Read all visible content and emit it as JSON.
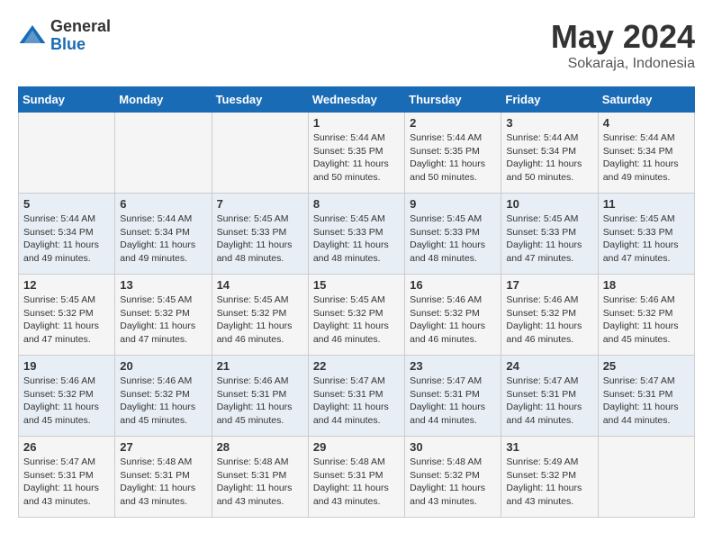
{
  "logo": {
    "general": "General",
    "blue": "Blue"
  },
  "title": {
    "month": "May 2024",
    "location": "Sokaraja, Indonesia"
  },
  "headers": [
    "Sunday",
    "Monday",
    "Tuesday",
    "Wednesday",
    "Thursday",
    "Friday",
    "Saturday"
  ],
  "weeks": [
    [
      {
        "day": "",
        "info": ""
      },
      {
        "day": "",
        "info": ""
      },
      {
        "day": "",
        "info": ""
      },
      {
        "day": "1",
        "info": "Sunrise: 5:44 AM\nSunset: 5:35 PM\nDaylight: 11 hours\nand 50 minutes."
      },
      {
        "day": "2",
        "info": "Sunrise: 5:44 AM\nSunset: 5:35 PM\nDaylight: 11 hours\nand 50 minutes."
      },
      {
        "day": "3",
        "info": "Sunrise: 5:44 AM\nSunset: 5:34 PM\nDaylight: 11 hours\nand 50 minutes."
      },
      {
        "day": "4",
        "info": "Sunrise: 5:44 AM\nSunset: 5:34 PM\nDaylight: 11 hours\nand 49 minutes."
      }
    ],
    [
      {
        "day": "5",
        "info": "Sunrise: 5:44 AM\nSunset: 5:34 PM\nDaylight: 11 hours\nand 49 minutes."
      },
      {
        "day": "6",
        "info": "Sunrise: 5:44 AM\nSunset: 5:34 PM\nDaylight: 11 hours\nand 49 minutes."
      },
      {
        "day": "7",
        "info": "Sunrise: 5:45 AM\nSunset: 5:33 PM\nDaylight: 11 hours\nand 48 minutes."
      },
      {
        "day": "8",
        "info": "Sunrise: 5:45 AM\nSunset: 5:33 PM\nDaylight: 11 hours\nand 48 minutes."
      },
      {
        "day": "9",
        "info": "Sunrise: 5:45 AM\nSunset: 5:33 PM\nDaylight: 11 hours\nand 48 minutes."
      },
      {
        "day": "10",
        "info": "Sunrise: 5:45 AM\nSunset: 5:33 PM\nDaylight: 11 hours\nand 47 minutes."
      },
      {
        "day": "11",
        "info": "Sunrise: 5:45 AM\nSunset: 5:33 PM\nDaylight: 11 hours\nand 47 minutes."
      }
    ],
    [
      {
        "day": "12",
        "info": "Sunrise: 5:45 AM\nSunset: 5:32 PM\nDaylight: 11 hours\nand 47 minutes."
      },
      {
        "day": "13",
        "info": "Sunrise: 5:45 AM\nSunset: 5:32 PM\nDaylight: 11 hours\nand 47 minutes."
      },
      {
        "day": "14",
        "info": "Sunrise: 5:45 AM\nSunset: 5:32 PM\nDaylight: 11 hours\nand 46 minutes."
      },
      {
        "day": "15",
        "info": "Sunrise: 5:45 AM\nSunset: 5:32 PM\nDaylight: 11 hours\nand 46 minutes."
      },
      {
        "day": "16",
        "info": "Sunrise: 5:46 AM\nSunset: 5:32 PM\nDaylight: 11 hours\nand 46 minutes."
      },
      {
        "day": "17",
        "info": "Sunrise: 5:46 AM\nSunset: 5:32 PM\nDaylight: 11 hours\nand 46 minutes."
      },
      {
        "day": "18",
        "info": "Sunrise: 5:46 AM\nSunset: 5:32 PM\nDaylight: 11 hours\nand 45 minutes."
      }
    ],
    [
      {
        "day": "19",
        "info": "Sunrise: 5:46 AM\nSunset: 5:32 PM\nDaylight: 11 hours\nand 45 minutes."
      },
      {
        "day": "20",
        "info": "Sunrise: 5:46 AM\nSunset: 5:32 PM\nDaylight: 11 hours\nand 45 minutes."
      },
      {
        "day": "21",
        "info": "Sunrise: 5:46 AM\nSunset: 5:31 PM\nDaylight: 11 hours\nand 45 minutes."
      },
      {
        "day": "22",
        "info": "Sunrise: 5:47 AM\nSunset: 5:31 PM\nDaylight: 11 hours\nand 44 minutes."
      },
      {
        "day": "23",
        "info": "Sunrise: 5:47 AM\nSunset: 5:31 PM\nDaylight: 11 hours\nand 44 minutes."
      },
      {
        "day": "24",
        "info": "Sunrise: 5:47 AM\nSunset: 5:31 PM\nDaylight: 11 hours\nand 44 minutes."
      },
      {
        "day": "25",
        "info": "Sunrise: 5:47 AM\nSunset: 5:31 PM\nDaylight: 11 hours\nand 44 minutes."
      }
    ],
    [
      {
        "day": "26",
        "info": "Sunrise: 5:47 AM\nSunset: 5:31 PM\nDaylight: 11 hours\nand 43 minutes."
      },
      {
        "day": "27",
        "info": "Sunrise: 5:48 AM\nSunset: 5:31 PM\nDaylight: 11 hours\nand 43 minutes."
      },
      {
        "day": "28",
        "info": "Sunrise: 5:48 AM\nSunset: 5:31 PM\nDaylight: 11 hours\nand 43 minutes."
      },
      {
        "day": "29",
        "info": "Sunrise: 5:48 AM\nSunset: 5:31 PM\nDaylight: 11 hours\nand 43 minutes."
      },
      {
        "day": "30",
        "info": "Sunrise: 5:48 AM\nSunset: 5:32 PM\nDaylight: 11 hours\nand 43 minutes."
      },
      {
        "day": "31",
        "info": "Sunrise: 5:49 AM\nSunset: 5:32 PM\nDaylight: 11 hours\nand 43 minutes."
      },
      {
        "day": "",
        "info": ""
      }
    ]
  ]
}
